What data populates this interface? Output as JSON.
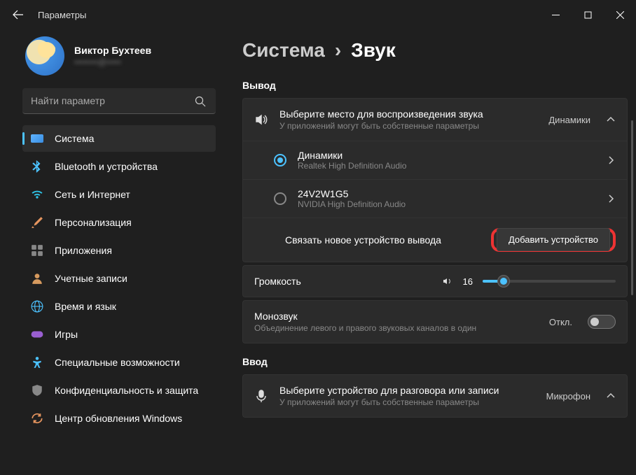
{
  "window": {
    "title": "Параметры"
  },
  "user": {
    "name": "Виктор Бухтеев",
    "email": "••••••••@•••••"
  },
  "search": {
    "placeholder": "Найти параметр"
  },
  "sidebar": {
    "items": [
      {
        "label": "Система"
      },
      {
        "label": "Bluetooth и устройства"
      },
      {
        "label": "Сеть и Интернет"
      },
      {
        "label": "Персонализация"
      },
      {
        "label": "Приложения"
      },
      {
        "label": "Учетные записи"
      },
      {
        "label": "Время и язык"
      },
      {
        "label": "Игры"
      },
      {
        "label": "Специальные возможности"
      },
      {
        "label": "Конфиденциальность и защита"
      },
      {
        "label": "Центр обновления Windows"
      }
    ]
  },
  "breadcrumb": {
    "parent": "Система",
    "sep": "›",
    "current": "Звук"
  },
  "sections": {
    "output_label": "Вывод",
    "input_label": "Ввод"
  },
  "output": {
    "title": "Выберите место для воспроизведения звука",
    "sub": "У приложений могут быть собственные параметры",
    "selected": "Динамики",
    "devices": [
      {
        "name": "Динамики",
        "driver": "Realtek High Definition Audio"
      },
      {
        "name": "24V2W1G5",
        "driver": "NVIDIA High Definition Audio"
      }
    ],
    "pair_label": "Связать новое устройство вывода",
    "add_button": "Добавить устройство"
  },
  "volume": {
    "label": "Громкость",
    "value": "16"
  },
  "mono": {
    "title": "Монозвук",
    "sub": "Объединение левого и правого звуковых каналов в один",
    "state": "Откл."
  },
  "input": {
    "title": "Выберите устройство для разговора или записи",
    "sub": "У приложений могут быть собственные параметры",
    "selected": "Микрофон"
  }
}
